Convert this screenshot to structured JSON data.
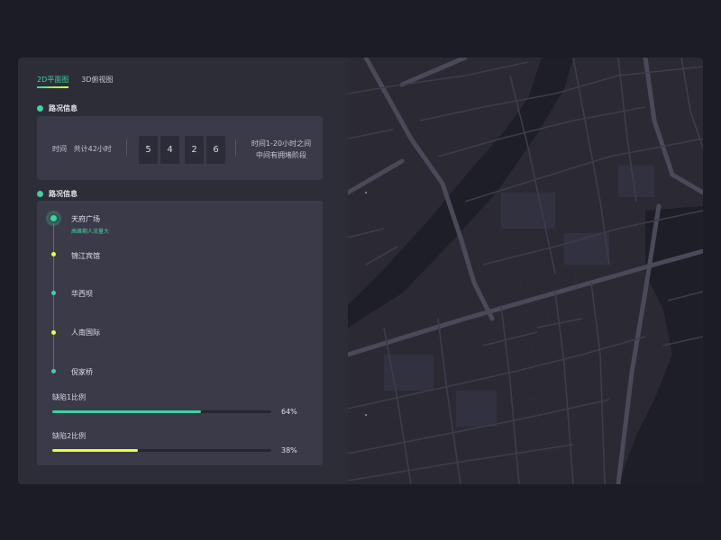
{
  "tabs": [
    {
      "label": "2D平面图",
      "active": true
    },
    {
      "label": "3D俯视图",
      "active": false
    }
  ],
  "traffic_section": {
    "title": "路况信息"
  },
  "time_info": {
    "label": "时间   共计42小时",
    "digits": [
      "5",
      "4",
      "2",
      "6"
    ],
    "note_line1": "时间1-20小时之间",
    "note_line2": "中间有拥堵阶段"
  },
  "route_section": {
    "title": "路况信息"
  },
  "stops": [
    {
      "name": "天府广场",
      "sub": "高峰期人流量大",
      "color": "#3ed3a0"
    },
    {
      "name": "锦江宾馆",
      "color": "#e8ff3a"
    },
    {
      "name": "华西坝",
      "color": "#3ed3a0"
    },
    {
      "name": "人南国际",
      "color": "#e8ff3a"
    },
    {
      "name": "倪家桥",
      "color": "#3ed3a0"
    }
  ],
  "ratios": [
    {
      "label": "缺陷1比例",
      "percent_text": "64%",
      "value": 0.68,
      "color": "#3ed3a0"
    },
    {
      "label": "缺陷2比例",
      "percent_text": "38%",
      "value": 0.39,
      "color": "#e8ff3a"
    }
  ],
  "colors": {
    "accent": "#3ed3a0",
    "highlight": "#e8ff3a"
  }
}
